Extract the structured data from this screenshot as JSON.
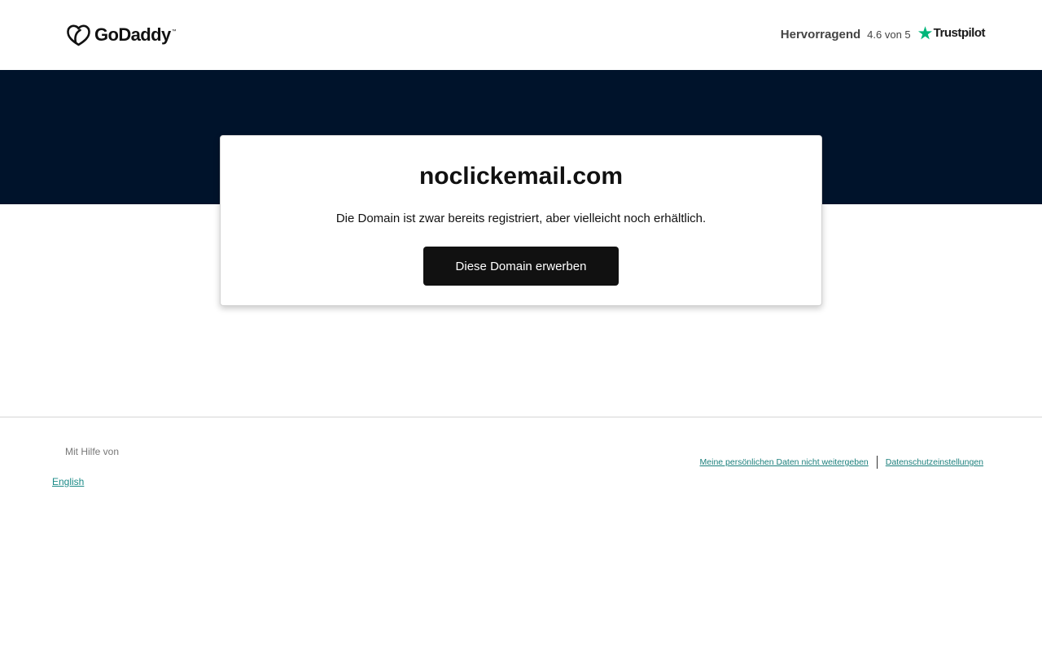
{
  "header": {
    "logo_text": "GoDaddy",
    "logo_tm": "™",
    "rating_word": "Hervorragend",
    "rating_score": "4.6 von 5",
    "trustpilot_label": "Trustpilot"
  },
  "card": {
    "domain": "noclickemail.com",
    "description": "Die Domain ist zwar bereits registriert, aber vielleicht noch erhältlich.",
    "button_label": "Diese Domain erwerben"
  },
  "footer": {
    "powered_by": "Mit Hilfe von",
    "language_link": "English",
    "legal_links": [
      "Meine persönlichen Daten nicht weitergeben",
      "Datenschutzeinstellungen"
    ]
  },
  "colors": {
    "hero_background": "#00132b",
    "button_background": "#111111",
    "link": "#1b8a87",
    "trustpilot_green": "#00b67a"
  },
  "icons": {
    "logo": "godaddy-logo-icon",
    "trustpilot": "trustpilot-star-icon"
  }
}
